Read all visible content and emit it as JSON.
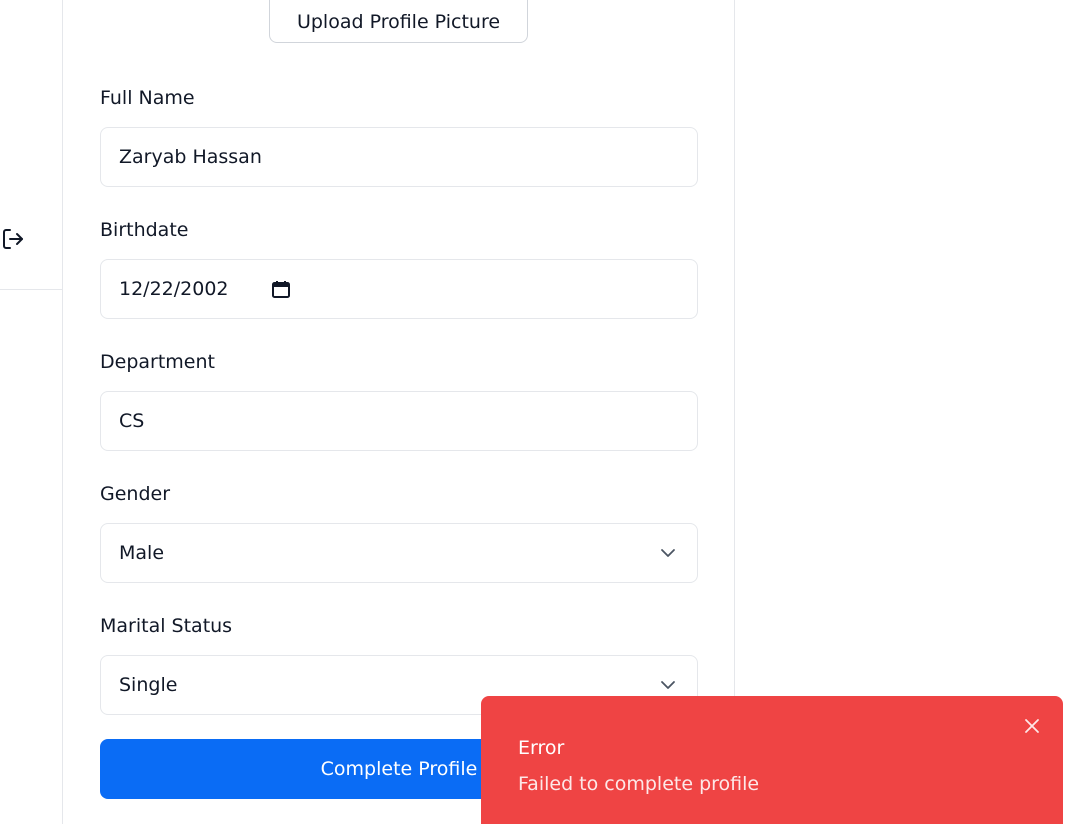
{
  "profile_form": {
    "upload_button_label": "Upload Profile Picture",
    "full_name": {
      "label": "Full Name",
      "value": "Zaryab Hassan"
    },
    "birthdate": {
      "label": "Birthdate",
      "value": "12/22/2002"
    },
    "department": {
      "label": "Department",
      "value": "CS"
    },
    "gender": {
      "label": "Gender",
      "value": "Male"
    },
    "marital_status": {
      "label": "Marital Status",
      "value": "Single"
    },
    "submit_label": "Complete Profile"
  },
  "sidebar": {
    "logout_icon": "logout-icon"
  },
  "toast": {
    "title": "Error",
    "message": "Failed to complete profile",
    "close_icon": "close-icon"
  },
  "colors": {
    "primary": "#0a6cf5",
    "error": "#ef4444",
    "border": "#e5e7eb"
  }
}
